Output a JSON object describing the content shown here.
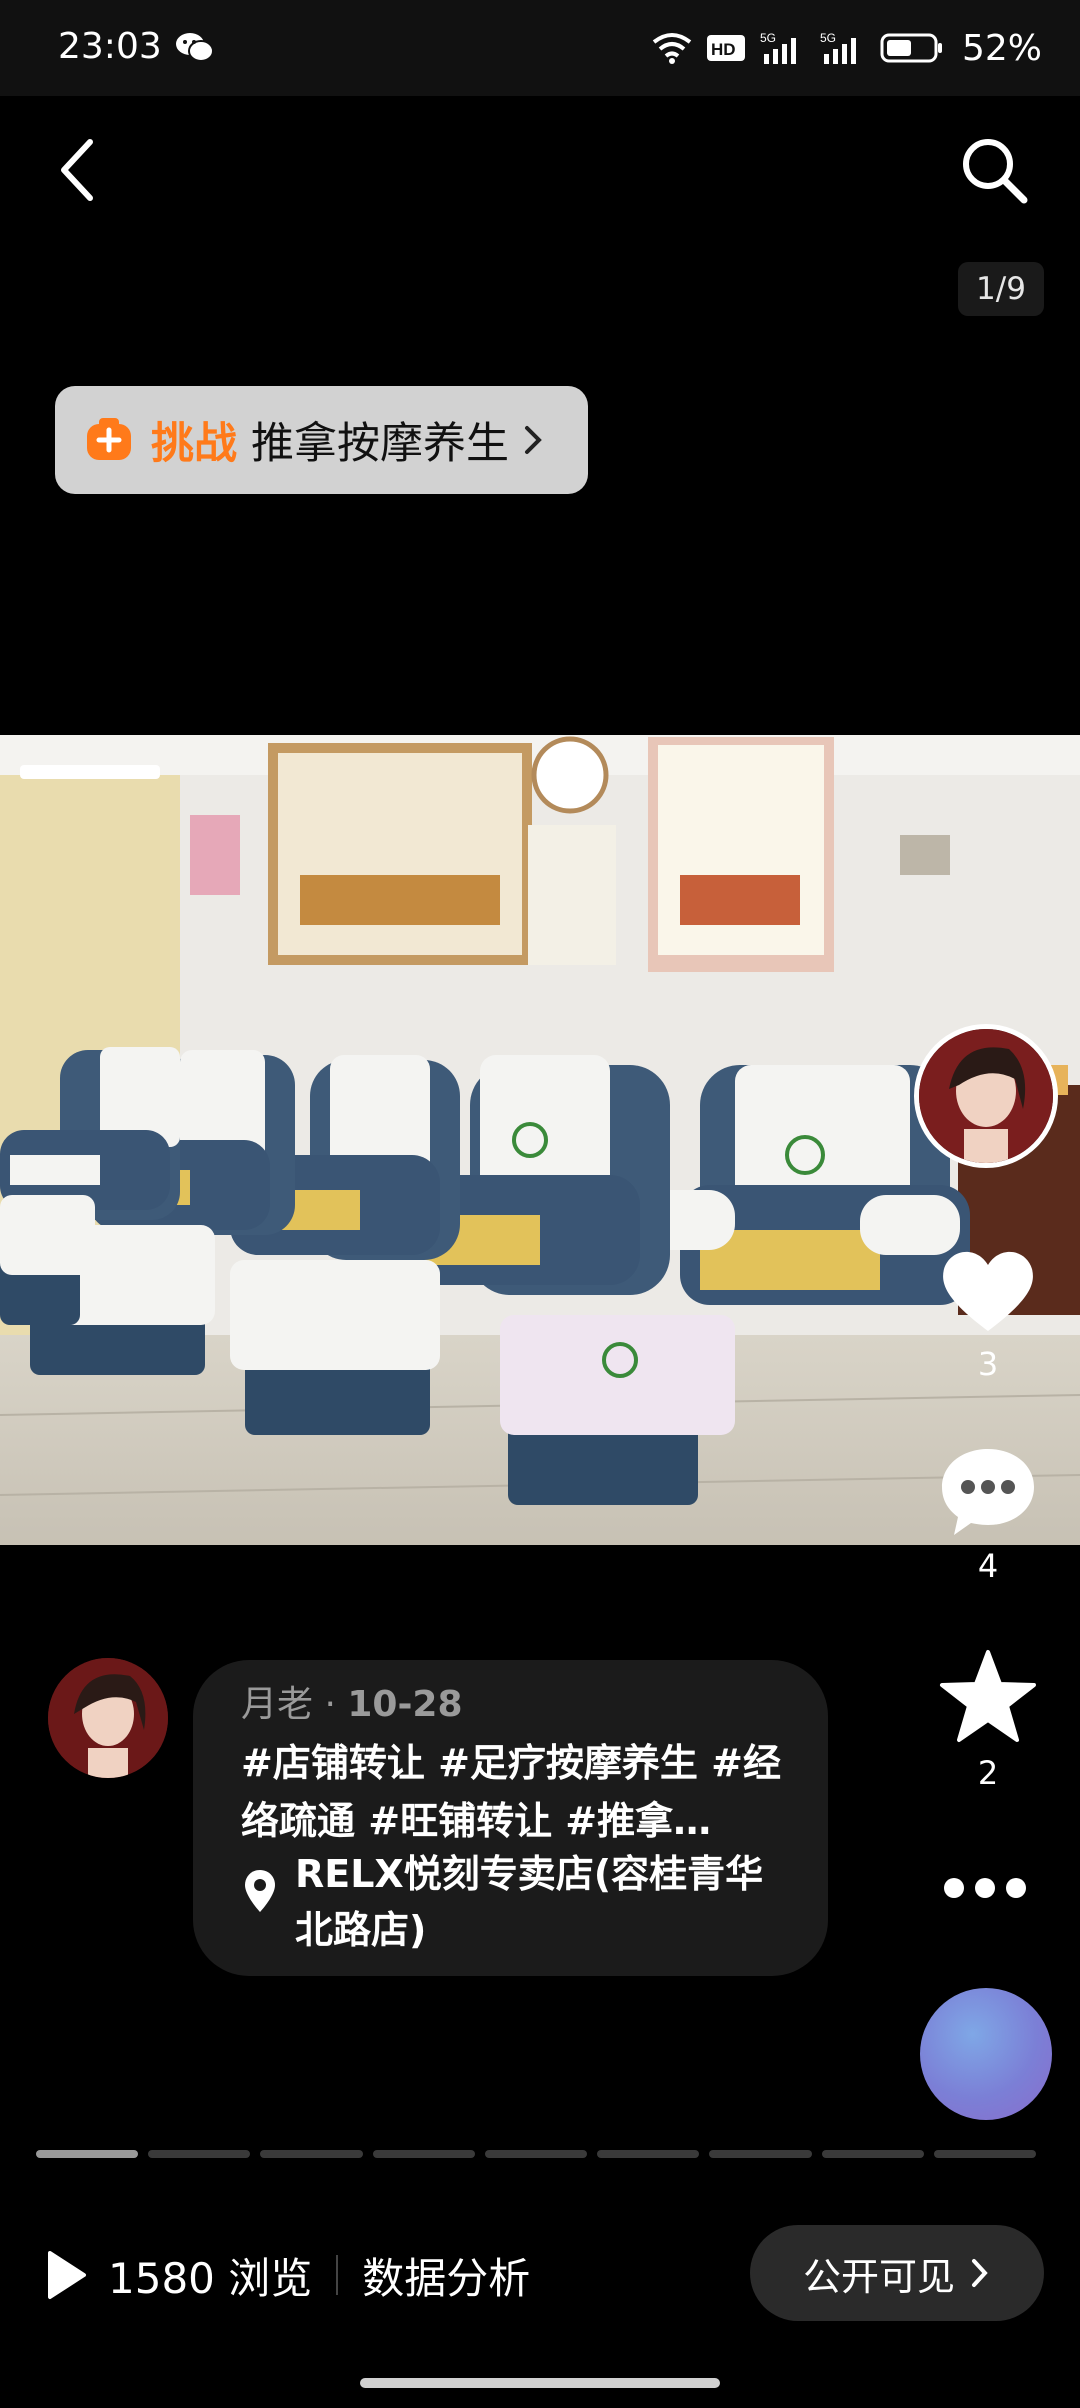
{
  "status_bar": {
    "time": "23:03",
    "battery": "52%",
    "icons": [
      "wechat-icon",
      "wifi-icon",
      "hd-icon",
      "signal-5g-icon",
      "signal-5g-icon",
      "battery-icon"
    ]
  },
  "nav": {
    "back_icon": "back-chevron-icon",
    "search_icon": "search-icon",
    "page_counter": "1/9"
  },
  "challenge": {
    "label": "挑战",
    "topic": "推拿按摩养生",
    "accent": "#ff7a1a"
  },
  "rail": {
    "like_count": "3",
    "comment_count": "4",
    "favorite_count": "2"
  },
  "post": {
    "author": "月老",
    "separator": " · ",
    "date": "10-28",
    "text": "#店铺转让 #足疗按摩养生 #经络疏通 #旺铺转让 #推拿…",
    "location": "RELX悦刻专卖店(容桂青华北路店)"
  },
  "progress": {
    "total": 9,
    "current": 1
  },
  "bottom": {
    "views": "1580 浏览",
    "analytics": "数据分析",
    "visibility": "公开可见"
  }
}
